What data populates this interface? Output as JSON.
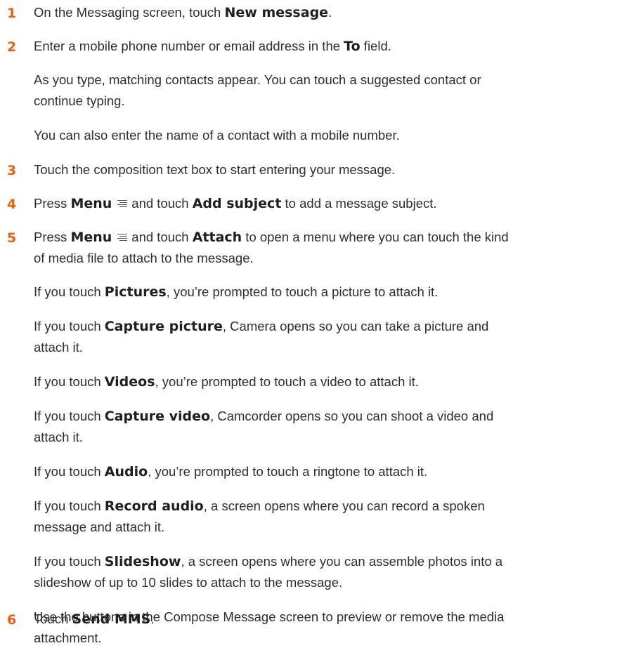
{
  "steps": {
    "s1": {
      "num": "1",
      "pre": "On the Messaging screen, touch ",
      "b1": "New message",
      "post": "."
    },
    "s2": {
      "num": "2",
      "pre": "Enter a mobile phone number or email address in the ",
      "b1": "To",
      "post": " field.",
      "p1a": "As you type, matching contacts appear. You can touch a suggested contact or",
      "p1b": "continue typing.",
      "p2": "You can also enter the name of a contact with a mobile number."
    },
    "s3": {
      "num": "3",
      "text": "Touch the composition text box to start entering your message."
    },
    "s4": {
      "num": "4",
      "pre": "Press ",
      "b1": "Menu",
      "mid": "and touch ",
      "b2": "Add subject",
      "post": " to add a message subject."
    },
    "s5": {
      "num": "5",
      "pre": "Press ",
      "b1": "Menu",
      "mid": "and touch ",
      "b2": "Attach",
      "post": " to open a menu where you can touch the kind",
      "line2": "of media file to attach to the message.",
      "pictures": {
        "pre": "If you touch ",
        "b": "Pictures",
        "post": ", you’re prompted to touch a picture to attach it."
      },
      "capture_picture": {
        "pre": "If you touch ",
        "b": "Capture picture",
        "post": ", Camera opens so you can take a picture and",
        "line2": "attach it."
      },
      "videos": {
        "pre": "If you touch ",
        "b": "Videos",
        "post": ", you’re prompted to touch a video to attach it."
      },
      "capture_video": {
        "pre": "If you touch ",
        "b": "Capture video",
        "post": ", Camcorder opens so you can shoot a video and",
        "line2": "attach it."
      },
      "audio": {
        "pre": "If you touch ",
        "b": "Audio",
        "post": ", you’re prompted to touch a ringtone to attach it."
      },
      "record_audio": {
        "pre": "If you touch ",
        "b": "Record audio",
        "post": ", a screen opens where you can record a spoken",
        "line2": "message and attach it."
      },
      "slideshow": {
        "pre": "If you touch ",
        "b": "Slideshow",
        "post": ", a screen opens where you can assemble photos into a",
        "line2": "slideshow of up to 10 slides to attach to the message."
      },
      "buttons_note": {
        "line1": "Use the buttons in the Compose Message screen to preview or remove the media",
        "line2": "attachment."
      }
    },
    "s6": {
      "num": "6",
      "pre": "Touch ",
      "b1": "Send MMS",
      "post": "."
    }
  },
  "icons": {
    "menu": "menu-icon"
  },
  "colors": {
    "step_number": "#e8600c",
    "text": "#2e2e2e"
  }
}
